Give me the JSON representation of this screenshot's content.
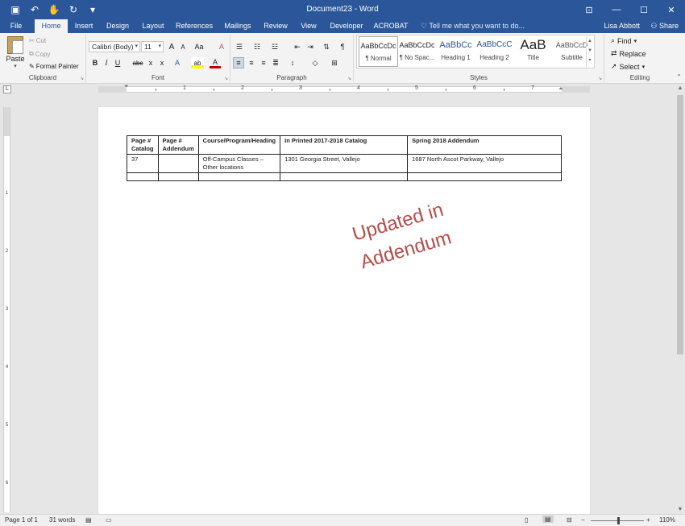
{
  "titlebar": {
    "title": "Document23 - Word",
    "qat": [
      {
        "icon": "save-icon",
        "glyph": "▣"
      },
      {
        "icon": "undo-icon",
        "glyph": "↶"
      },
      {
        "icon": "touch-mode-icon",
        "glyph": "✋"
      },
      {
        "icon": "redo-icon",
        "glyph": "↻"
      },
      {
        "icon": "customize-qat-icon",
        "glyph": "▾"
      }
    ],
    "window_buttons": [
      {
        "icon": "ribbon-display-icon",
        "glyph": "⊡"
      },
      {
        "icon": "minimize-icon",
        "glyph": "—"
      },
      {
        "icon": "maximize-icon",
        "glyph": "☐"
      },
      {
        "icon": "close-icon",
        "glyph": "✕"
      }
    ]
  },
  "tabs": [
    "File",
    "Home",
    "Insert",
    "Design",
    "Layout",
    "References",
    "Mailings",
    "Review",
    "View",
    "Developer",
    "ACROBAT"
  ],
  "active_tab": "Home",
  "tell_me": "Tell me what you want to do...",
  "user": "Lisa Abbott",
  "share": "Share",
  "clipboard": {
    "paste": "Paste",
    "cut": "Cut",
    "copy": "Copy",
    "format_painter": "Format Painter",
    "label": "Clipboard"
  },
  "font": {
    "name": "Calibri (Body)",
    "size": "11",
    "grow": "A",
    "shrink": "A",
    "case": "Aa",
    "clear": "A",
    "bold": "B",
    "italic": "I",
    "underline": "U",
    "strike": "abc",
    "subscript": "x",
    "superscript": "x",
    "effects": "A",
    "highlight": "ab",
    "color": "A",
    "label": "Font"
  },
  "paragraph": {
    "label": "Paragraph",
    "pilcrow": "¶"
  },
  "styles": {
    "label": "Styles",
    "items": [
      {
        "sample": "AaBbCcDc",
        "name": "¶ Normal"
      },
      {
        "sample": "AaBbCcDc",
        "name": "¶ No Spac..."
      },
      {
        "sample": "AaBbCc",
        "name": "Heading 1"
      },
      {
        "sample": "AaBbCcC",
        "name": "Heading 2"
      },
      {
        "sample": "AaB",
        "name": "Title"
      },
      {
        "sample": "AaBbCcD",
        "name": "Subtitle"
      }
    ]
  },
  "editing": {
    "find": "Find",
    "replace": "Replace",
    "select": "Select",
    "label": "Editing"
  },
  "ruler": {
    "h_numbers": [
      "1",
      "2",
      "3",
      "4",
      "5",
      "6",
      "7"
    ],
    "v_numbers": [
      "1",
      "2",
      "3",
      "4",
      "5",
      "6"
    ]
  },
  "document": {
    "table": {
      "headers": [
        "Page # Catalog",
        "Page # Addendum",
        "Course/Program/Heading",
        "In Printed 2017-2018 Catalog",
        "Spring 2018 Addendum"
      ],
      "rows": [
        [
          "37",
          "",
          "Off-Campus Classes – Other locations",
          "1301 Georgia Street, Vallejo",
          "1687 North Ascot Parkway, Vallejo"
        ],
        [
          "",
          "",
          "",
          "",
          ""
        ]
      ]
    },
    "stamp_line1": "Updated in",
    "stamp_line2": "Addendum",
    "stamp_color": "#b94a4a"
  },
  "status": {
    "page": "Page 1 of 1",
    "words": "31 words",
    "zoom": "110%",
    "zoom_minus": "−",
    "zoom_plus": "+"
  },
  "colors": {
    "brand": "#2b579a",
    "ribbon": "#f3f3f3"
  }
}
